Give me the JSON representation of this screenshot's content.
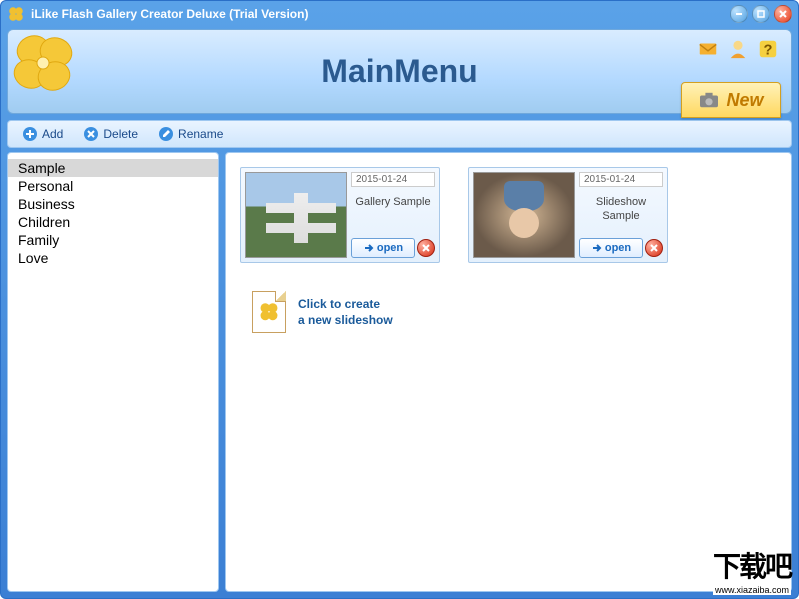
{
  "window": {
    "title": "iLike Flash Gallery Creator Deluxe (Trial Version)"
  },
  "header": {
    "title": "MainMenu",
    "new_button": "New"
  },
  "toolbar": {
    "add": "Add",
    "delete": "Delete",
    "rename": "Rename"
  },
  "sidebar": {
    "items": [
      {
        "label": "Sample",
        "selected": true
      },
      {
        "label": "Personal",
        "selected": false
      },
      {
        "label": "Business",
        "selected": false
      },
      {
        "label": "Children",
        "selected": false
      },
      {
        "label": "Family",
        "selected": false
      },
      {
        "label": "Love",
        "selected": false
      }
    ]
  },
  "galleries": [
    {
      "date": "2015-01-24",
      "title": "Gallery Sample",
      "open": "open"
    },
    {
      "date": "2015-01-24",
      "title": "Slideshow Sample",
      "open": "open"
    }
  ],
  "create_new": {
    "line1": "Click to create",
    "line2": "a new slideshow"
  },
  "watermark": {
    "text": "下载吧",
    "url": "www.xiazaiba.com"
  }
}
